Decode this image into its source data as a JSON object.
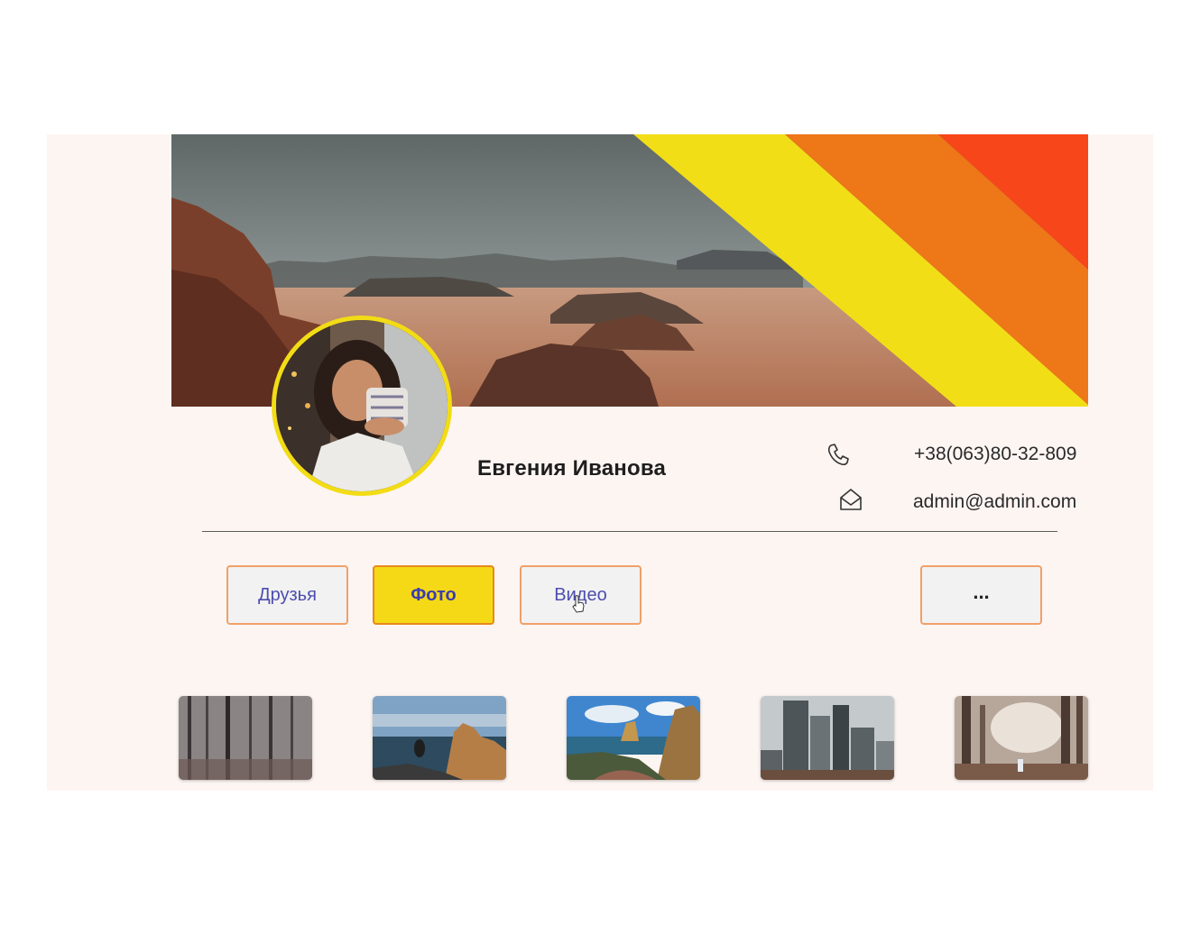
{
  "profile": {
    "name": "Евгения Иванова",
    "phone": "+38(063)80-32-809",
    "email": "admin@admin.com"
  },
  "icons": {
    "phone": "phone-icon",
    "email": "envelope-icon"
  },
  "tabs": [
    {
      "label": "Друзья",
      "active": false
    },
    {
      "label": "Фото",
      "active": true
    },
    {
      "label": "Видео",
      "active": false
    }
  ],
  "more_button": {
    "label": "..."
  },
  "photos": [
    "forest-photo",
    "sea-rocks-photo",
    "beach-photo",
    "city-photo",
    "foggy-forest-photo"
  ],
  "colors": {
    "accent_yellow": "#f5d916",
    "accent_orange": "#ee7718",
    "accent_red": "#f6461a",
    "background": "#fdf5f2",
    "button_text": "#4d4daf"
  }
}
